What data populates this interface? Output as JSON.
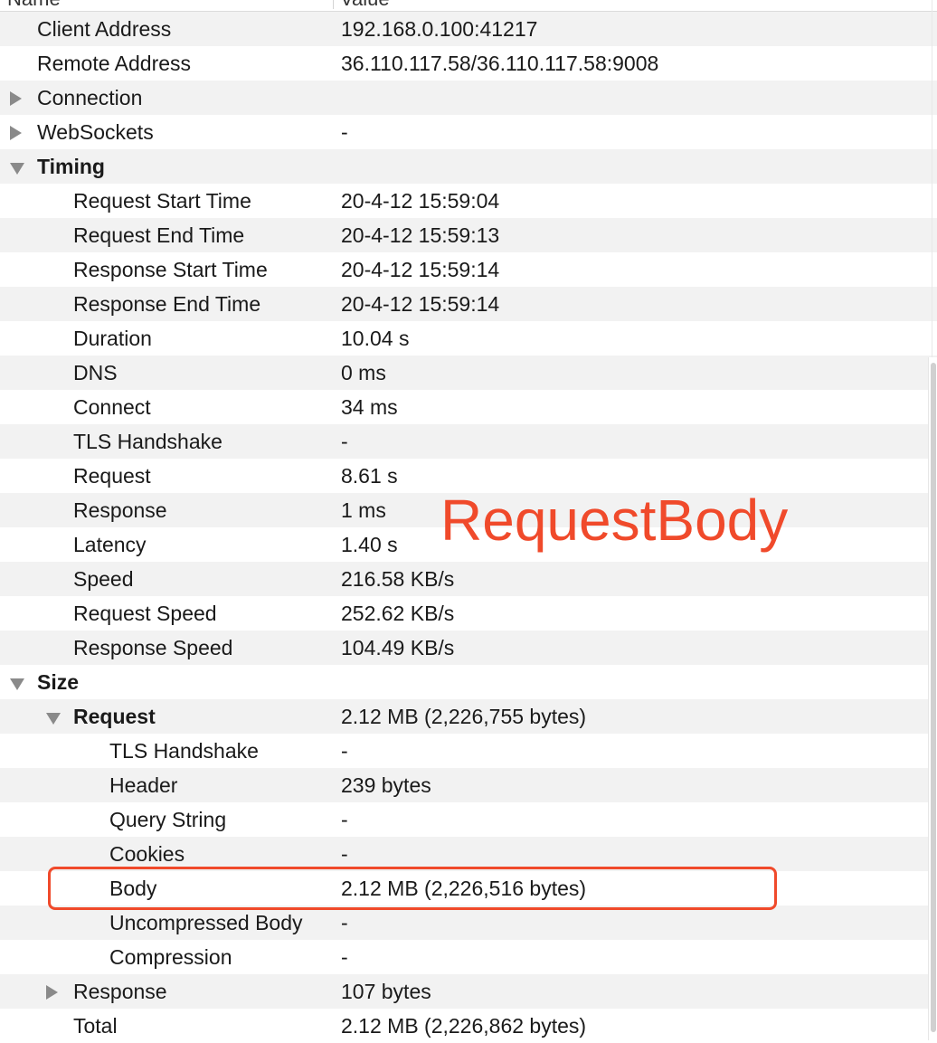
{
  "columns": {
    "name": "Name",
    "value": "Value"
  },
  "rows": [
    {
      "name": "Client Address",
      "value": "192.168.0.100:41217",
      "indent": 0,
      "toggle": "none",
      "bold": false
    },
    {
      "name": "Remote Address",
      "value": "36.110.117.58/36.110.117.58:9008",
      "indent": 0,
      "toggle": "none",
      "bold": false
    },
    {
      "name": "Connection",
      "value": "",
      "indent": 0,
      "toggle": "collapsed",
      "bold": false
    },
    {
      "name": "WebSockets",
      "value": "-",
      "indent": 0,
      "toggle": "collapsed",
      "bold": false
    },
    {
      "name": "Timing",
      "value": "",
      "indent": 0,
      "toggle": "expanded",
      "bold": true
    },
    {
      "name": "Request Start Time",
      "value": "20-4-12 15:59:04",
      "indent": 1,
      "toggle": "none",
      "bold": false
    },
    {
      "name": "Request End Time",
      "value": "20-4-12 15:59:13",
      "indent": 1,
      "toggle": "none",
      "bold": false
    },
    {
      "name": "Response Start Time",
      "value": "20-4-12 15:59:14",
      "indent": 1,
      "toggle": "none",
      "bold": false
    },
    {
      "name": "Response End Time",
      "value": "20-4-12 15:59:14",
      "indent": 1,
      "toggle": "none",
      "bold": false
    },
    {
      "name": "Duration",
      "value": "10.04 s",
      "indent": 1,
      "toggle": "none",
      "bold": false
    },
    {
      "name": "DNS",
      "value": "0 ms",
      "indent": 1,
      "toggle": "none",
      "bold": false
    },
    {
      "name": "Connect",
      "value": "34 ms",
      "indent": 1,
      "toggle": "none",
      "bold": false
    },
    {
      "name": "TLS Handshake",
      "value": "-",
      "indent": 1,
      "toggle": "none",
      "bold": false
    },
    {
      "name": "Request",
      "value": "8.61 s",
      "indent": 1,
      "toggle": "none",
      "bold": false
    },
    {
      "name": "Response",
      "value": "1 ms",
      "indent": 1,
      "toggle": "none",
      "bold": false
    },
    {
      "name": "Latency",
      "value": "1.40 s",
      "indent": 1,
      "toggle": "none",
      "bold": false
    },
    {
      "name": "Speed",
      "value": "216.58 KB/s",
      "indent": 1,
      "toggle": "none",
      "bold": false
    },
    {
      "name": "Request Speed",
      "value": "252.62 KB/s",
      "indent": 1,
      "toggle": "none",
      "bold": false
    },
    {
      "name": "Response Speed",
      "value": "104.49 KB/s",
      "indent": 1,
      "toggle": "none",
      "bold": false
    },
    {
      "name": "Size",
      "value": "",
      "indent": 0,
      "toggle": "expanded",
      "bold": true
    },
    {
      "name": "Request",
      "value": "2.12 MB (2,226,755 bytes)",
      "indent": 1,
      "toggle": "expanded",
      "bold": true
    },
    {
      "name": "TLS Handshake",
      "value": "-",
      "indent": 2,
      "toggle": "none",
      "bold": false
    },
    {
      "name": "Header",
      "value": "239 bytes",
      "indent": 2,
      "toggle": "none",
      "bold": false
    },
    {
      "name": "Query String",
      "value": "-",
      "indent": 2,
      "toggle": "none",
      "bold": false
    },
    {
      "name": "Cookies",
      "value": "-",
      "indent": 2,
      "toggle": "none",
      "bold": false
    },
    {
      "name": "Body",
      "value": "2.12 MB (2,226,516 bytes)",
      "indent": 2,
      "toggle": "none",
      "bold": false
    },
    {
      "name": "Uncompressed Body",
      "value": "-",
      "indent": 2,
      "toggle": "none",
      "bold": false
    },
    {
      "name": "Compression",
      "value": "-",
      "indent": 2,
      "toggle": "none",
      "bold": false
    },
    {
      "name": "Response",
      "value": "107 bytes",
      "indent": 1,
      "toggle": "collapsed",
      "bold": false
    },
    {
      "name": "Total",
      "value": "2.12 MB (2,226,862 bytes)",
      "indent": 1,
      "toggle": "none",
      "bold": false
    }
  ],
  "annotation": {
    "text": "RequestBody",
    "color": "#f04a2b"
  },
  "colors": {
    "row_shade": "#f2f2f2",
    "highlight": "#f04a2b",
    "disclosure": "#8a8a8a"
  }
}
